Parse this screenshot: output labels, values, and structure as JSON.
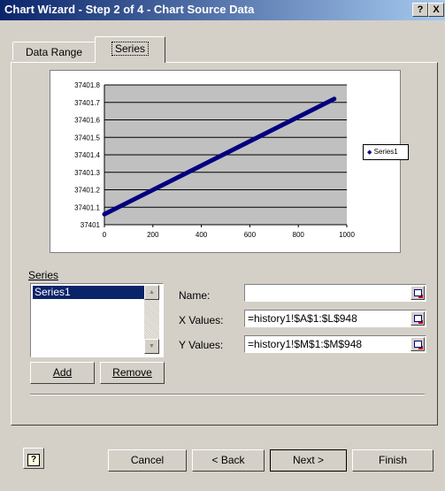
{
  "window": {
    "title": "Chart Wizard - Step 2 of 4 - Chart Source Data",
    "help_button": "?",
    "close_button": "X"
  },
  "tabs": [
    {
      "label": "Data Range",
      "active": false
    },
    {
      "label": "Series",
      "active": true
    }
  ],
  "preview_chart": {
    "legend_label": "Series1",
    "y_ticks": [
      "37401.8",
      "37401.7",
      "37401.6",
      "37401.5",
      "37401.4",
      "37401.3",
      "37401.2",
      "37401.1",
      "37401"
    ],
    "x_ticks": [
      "0",
      "200",
      "400",
      "600",
      "800",
      "1000"
    ]
  },
  "chart_data": {
    "type": "line",
    "series": [
      {
        "name": "Series1",
        "x": [
          0,
          948
        ],
        "y": [
          37401.06,
          37401.72
        ]
      }
    ],
    "xlim": [
      0,
      1000
    ],
    "ylim": [
      37401,
      37401.8
    ],
    "grid": true,
    "legend_position": "right",
    "colors": {
      "series": "#000080",
      "plot_area": "#c0c0c0"
    }
  },
  "series_panel": {
    "group_label": "Series",
    "items": [
      "Series1"
    ],
    "add_label": "Add",
    "remove_label": "Remove"
  },
  "fields": {
    "name_label": "Name:",
    "name_value": "",
    "x_label": "X Values:",
    "x_value": "=history1!$A$1:$L$948",
    "y_label": "Y Values:",
    "y_value": "=history1!$M$1:$M$948"
  },
  "footer": {
    "help_icon": "?",
    "cancel": "Cancel",
    "back": "< Back",
    "next": "Next >",
    "finish": "Finish"
  }
}
